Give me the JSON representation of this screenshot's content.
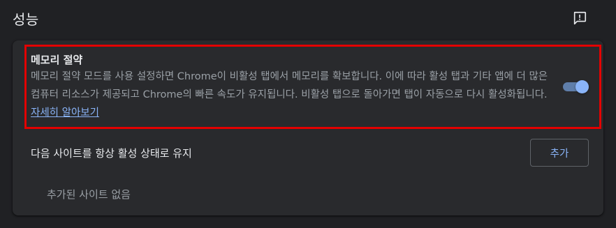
{
  "header": {
    "title": "성능",
    "feedback_icon": "feedback-icon"
  },
  "memory_saver": {
    "title": "메모리 절약",
    "description": "메모리 절약 모드를 사용 설정하면 Chrome이 비활성 탭에서 메모리를 확보합니다. 이에 따라 활성 탭과 기타 앱에 더 많은 컴퓨터 리소스가 제공되고 Chrome의 빠른 속도가 유지됩니다. 비활성 탭으로 돌아가면 탭이 자동으로 다시 활성화됩니다.",
    "learn_more": "자세히 알아보기",
    "enabled": true
  },
  "always_active": {
    "label": "다음 사이트를 항상 활성 상태로 유지",
    "add_button": "추가",
    "empty_text": "추가된 사이트 없음"
  },
  "colors": {
    "background": "#202124",
    "card": "#292a2d",
    "accent": "#8ab4f8",
    "highlight_border": "#e30000"
  }
}
